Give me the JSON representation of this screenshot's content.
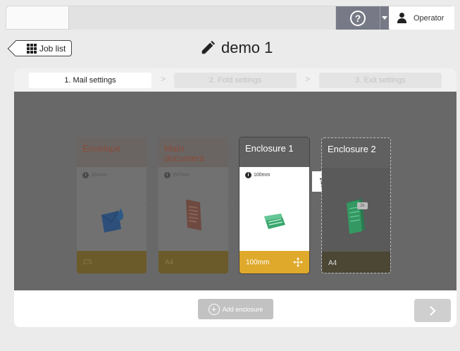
{
  "topbar": {
    "help_glyph": "?",
    "user_label": "Operator"
  },
  "header": {
    "job_list_label": "Job list",
    "job_title": "demo 1"
  },
  "steps": [
    {
      "label": "1. Mail settings",
      "active": true
    },
    {
      "label": "2. Fold settings",
      "active": false
    },
    {
      "label": "3. Exit settings",
      "active": false
    }
  ],
  "cards": [
    {
      "title": "Envelope",
      "info": "162mm",
      "footer": "C5",
      "icon": "envelope-icon"
    },
    {
      "title": "Main document",
      "info": "297mm",
      "footer": "A4",
      "icon": "document-icon"
    },
    {
      "title": "Enclosure 1",
      "info": "100mm",
      "footer": "100mm",
      "icon": "enclosure-icon"
    },
    {
      "title": "Enclosure 2",
      "info": "",
      "footer": "A4",
      "icon": "enclosure-stack-icon",
      "badge": "2x"
    }
  ],
  "bottombar": {
    "add_enclosure_label": "Add enclosure"
  },
  "colors": {
    "accent": "#dfa92c",
    "header_gray": "#777a86",
    "dark_area": "#686868"
  }
}
